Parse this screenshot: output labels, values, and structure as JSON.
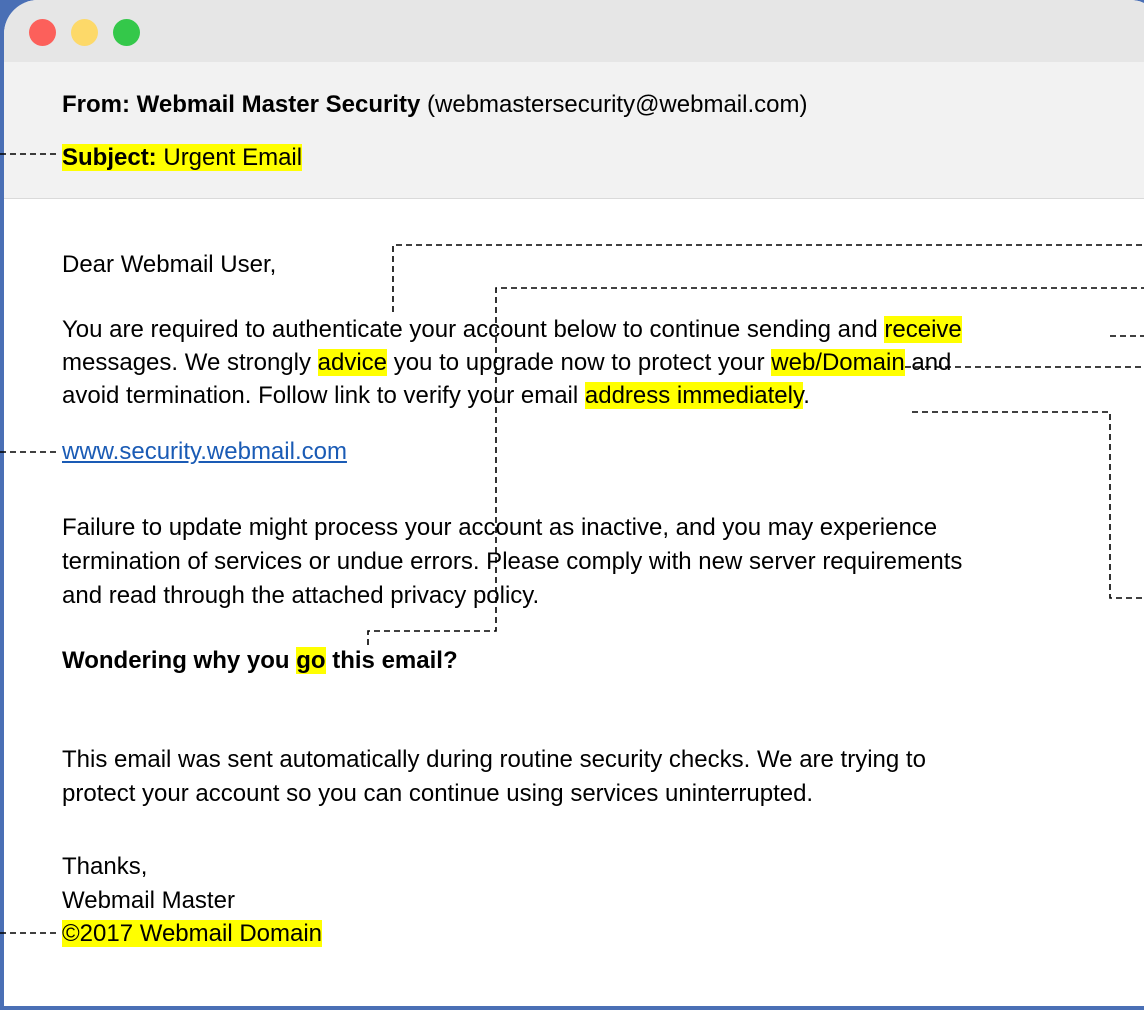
{
  "email": {
    "from_label": "From:",
    "from_name": "Webmail Master Security",
    "from_address": "(webmastersecurity@webmail.com)",
    "subject_label": "Subject:",
    "subject_text": "Urgent Email",
    "greeting": "Dear Webmail User,",
    "p1": {
      "l1a": "You are required to authenticate your account below to continue sending and ",
      "l1_receive": "receive",
      "l2a": "messages. We strongly ",
      "l2_advice": "advice",
      "l2b": " you to upgrade now to protect your ",
      "l2_domain": "web/Domain",
      "l2c": " and",
      "l3a": "avoid termination. Follow link to verify your email ",
      "l3_address": "address immediately",
      "l3b": "."
    },
    "link": "www.security.webmail.com",
    "p2": {
      "l1": "Failure to update might process your account as inactive, and you may experience",
      "l2": "termination of services or undue errors. Please comply with new server requirements",
      "l3": "and read through the attached privacy policy."
    },
    "question": {
      "a": "Wondering why you ",
      "go": "go",
      "b": " this email?"
    },
    "p3": {
      "l1": "This email was sent automatically during routine security checks. We are trying to",
      "l2": "protect your account so you can continue using services uninterrupted."
    },
    "closing": "Thanks,",
    "signature": "Webmail Master",
    "copyright": "©2017 Webmail Domain"
  },
  "colors": {
    "highlight": "#ffff00",
    "frame": "#4a6fb5",
    "link": "#1a5bb5"
  }
}
